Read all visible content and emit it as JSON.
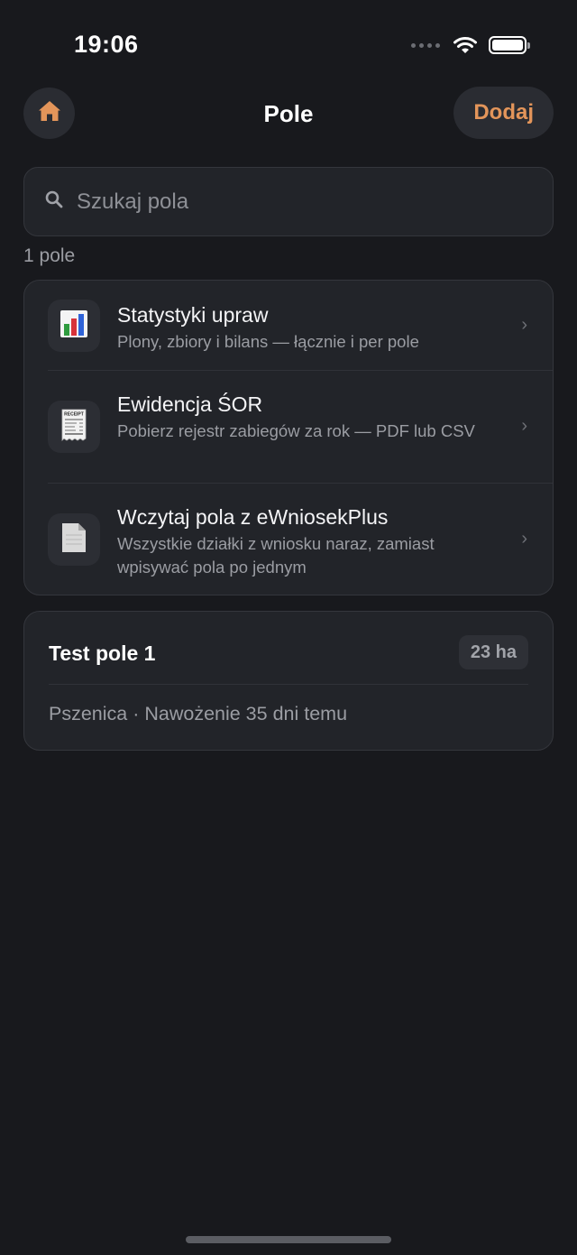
{
  "status_bar": {
    "time": "19:06"
  },
  "nav": {
    "title": "Pole",
    "add_label": "Dodaj"
  },
  "search": {
    "placeholder": "Szukaj pola",
    "value": ""
  },
  "list": {
    "count_label": "1 pole"
  },
  "tools": [
    {
      "title": "Statystyki upraw",
      "subtitle": "Plony, zbiory i bilans — łącznie i per pole",
      "icon": "bar-chart-icon"
    },
    {
      "title": "Ewidencja ŚOR",
      "subtitle": "Pobierz rejestr zabiegów za rok — PDF lub CSV",
      "icon": "receipt-icon",
      "icon_text": "RECEIPT"
    },
    {
      "title": "Wczytaj pola z eWniosekPlus",
      "subtitle": "Wszystkie działki z wniosku naraz, zamiast wpisywać pola po jednym",
      "icon": "document-icon"
    }
  ],
  "fields": [
    {
      "name": "Test pole 1",
      "area": "23 ha",
      "details": "Pszenica · Nawożenie 35 dni temu"
    }
  ],
  "colors": {
    "accent": "#e3955a",
    "background": "#18191d",
    "card": "#222429"
  }
}
